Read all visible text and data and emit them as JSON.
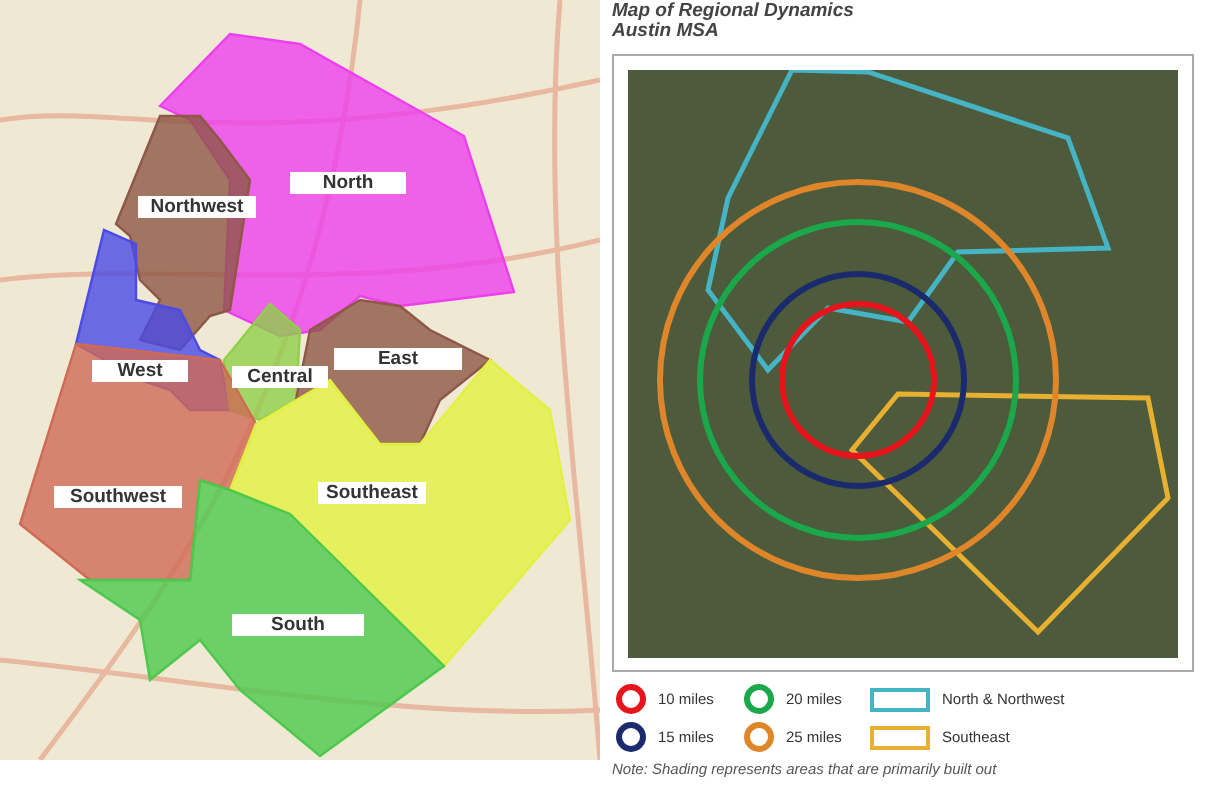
{
  "regions_map": {
    "regions": [
      {
        "name": "North",
        "color": "#ee3fee"
      },
      {
        "name": "Northwest",
        "color": "#8e5746"
      },
      {
        "name": "West",
        "color": "#4a4ae6"
      },
      {
        "name": "Central",
        "color": "#8fcf4a"
      },
      {
        "name": "East",
        "color": "#8e5746"
      },
      {
        "name": "Southwest",
        "color": "#cf6a55"
      },
      {
        "name": "Southeast",
        "color": "#e4f040"
      },
      {
        "name": "South",
        "color": "#4cc84c"
      }
    ]
  },
  "radius_map": {
    "title": "Map of Regional Dynamics",
    "subtitle": "Austin MSA",
    "legend": [
      {
        "kind": "ring",
        "label": "10 miles",
        "color": "#e8141c"
      },
      {
        "kind": "ring",
        "label": "20 miles",
        "color": "#1aa84a"
      },
      {
        "kind": "area",
        "label": "North & Northwest",
        "color": "#45b5c5"
      },
      {
        "kind": "ring",
        "label": "15 miles",
        "color": "#1a2a6c"
      },
      {
        "kind": "ring",
        "label": "25 miles",
        "color": "#e0862a"
      },
      {
        "kind": "area",
        "label": "Southeast",
        "color": "#e8b030"
      }
    ],
    "note": "Note: Shading represents areas that are primarily built out"
  }
}
